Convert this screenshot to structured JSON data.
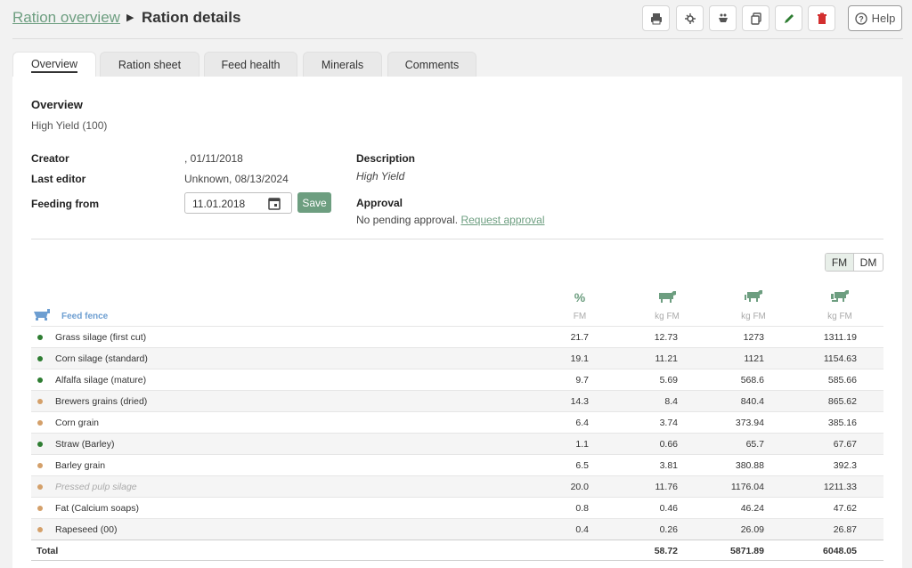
{
  "breadcrumb": {
    "parent": "Ration overview",
    "current": "Ration details"
  },
  "toolbar": {
    "help_label": "Help"
  },
  "tabs": [
    {
      "label": "Overview",
      "active": true
    },
    {
      "label": "Ration sheet"
    },
    {
      "label": "Feed health"
    },
    {
      "label": "Minerals"
    },
    {
      "label": "Comments"
    }
  ],
  "overview": {
    "title": "Overview",
    "subtitle": "High Yield (100)",
    "creator_label": "Creator",
    "creator_value": ", 01/11/2018",
    "last_editor_label": "Last editor",
    "last_editor_value": "Unknown, 08/13/2024",
    "feeding_from_label": "Feeding from",
    "feeding_from_value": "11.01.2018",
    "save_label": "Save",
    "description_label": "Description",
    "description_value": "High Yield",
    "approval_label": "Approval",
    "approval_text": "No pending approval.",
    "approval_link": "Request approval"
  },
  "unit_toggle": {
    "fm": "FM",
    "dm": "DM",
    "selected": "FM"
  },
  "table": {
    "feed_fence_label": "Feed fence",
    "pct_symbol": "%",
    "units": [
      "FM",
      "kg FM",
      "kg FM",
      "kg FM"
    ],
    "rows": [
      {
        "name": "Grass silage (first cut)",
        "dot": "#2e7d32",
        "pct": "21.7",
        "kg": "12.73",
        "kg2": "1273",
        "kg3": "1311.19"
      },
      {
        "name": "Corn silage (standard)",
        "dot": "#2e7d32",
        "pct": "19.1",
        "kg": "11.21",
        "kg2": "1121",
        "kg3": "1154.63"
      },
      {
        "name": "Alfalfa silage (mature)",
        "dot": "#2e7d32",
        "pct": "9.7",
        "kg": "5.69",
        "kg2": "568.6",
        "kg3": "585.66"
      },
      {
        "name": "Brewers grains (dried)",
        "dot": "#d4a06a",
        "pct": "14.3",
        "kg": "8.4",
        "kg2": "840.4",
        "kg3": "865.62"
      },
      {
        "name": "Corn grain",
        "dot": "#d4a06a",
        "pct": "6.4",
        "kg": "3.74",
        "kg2": "373.94",
        "kg3": "385.16"
      },
      {
        "name": "Straw (Barley)",
        "dot": "#2e7d32",
        "pct": "1.1",
        "kg": "0.66",
        "kg2": "65.7",
        "kg3": "67.67"
      },
      {
        "name": "Barley grain",
        "dot": "#d4a06a",
        "pct": "6.5",
        "kg": "3.81",
        "kg2": "380.88",
        "kg3": "392.3"
      },
      {
        "name": "Pressed pulp silage",
        "dot": "#d4a06a",
        "inactive": true,
        "pct": "20.0",
        "kg": "11.76",
        "kg2": "1176.04",
        "kg3": "1211.33"
      },
      {
        "name": "Fat (Calcium soaps)",
        "dot": "#d4a06a",
        "pct": "0.8",
        "kg": "0.46",
        "kg2": "46.24",
        "kg3": "47.62"
      },
      {
        "name": "Rapeseed (00)",
        "dot": "#d4a06a",
        "pct": "0.4",
        "kg": "0.26",
        "kg2": "26.09",
        "kg3": "26.87"
      }
    ],
    "total": {
      "name": "Total",
      "pct": "",
      "kg": "58.72",
      "kg2": "5871.89",
      "kg3": "6048.05"
    }
  }
}
